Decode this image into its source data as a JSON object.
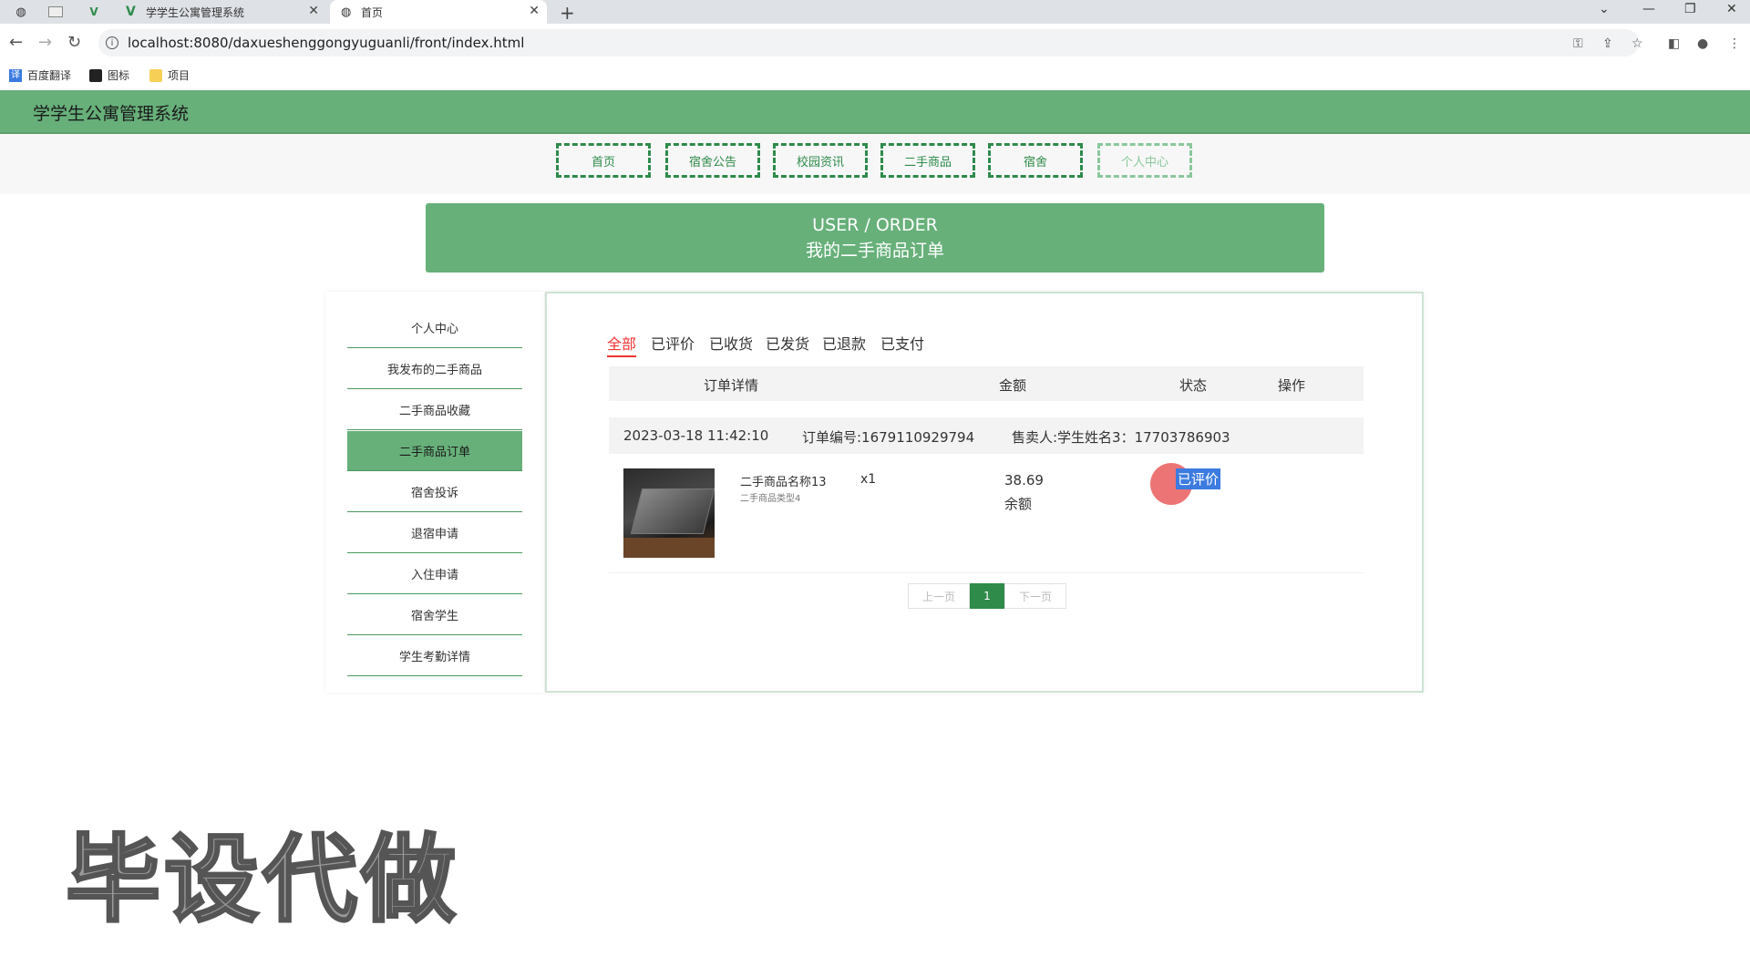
{
  "browser": {
    "tabs": [
      {
        "title": "学学生公寓管理系统"
      },
      {
        "title": "首页"
      }
    ],
    "url": "localhost:8080/daxueshenggongyuguanli/front/index.html",
    "bookmarks": [
      "百度翻译",
      "图标",
      "项目"
    ]
  },
  "site": {
    "title": "学学生公寓管理系统",
    "nav": [
      "首页",
      "宿舍公告",
      "校园资讯",
      "二手商品",
      "宿舍",
      "个人中心"
    ],
    "banner": {
      "en": "USER / ORDER",
      "cn": "我的二手商品订单"
    }
  },
  "sidebar": {
    "items": [
      "个人中心",
      "我发布的二手商品",
      "二手商品收藏",
      "二手商品订单",
      "宿舍投诉",
      "退宿申请",
      "入住申请",
      "宿舍学生",
      "学生考勤详情"
    ],
    "active_index": 3
  },
  "orders": {
    "filters": [
      "全部",
      "已评价",
      "已收货",
      "已发货",
      "已退款",
      "已支付"
    ],
    "active_filter": "全部",
    "columns": [
      "订单详情",
      "金额",
      "状态",
      "操作"
    ],
    "list": [
      {
        "time": "2023-03-18 11:42:10",
        "order_no": "订单编号:1679110929794",
        "seller": "售卖人:学生姓名3：17703786903",
        "item_name": "二手商品名称13",
        "item_type": "二手商品类型4",
        "qty": "x1",
        "amount": "38.69",
        "pay_method": "余额",
        "status": "已评价"
      }
    ]
  },
  "pagination": {
    "prev": "上一页",
    "current": "1",
    "next": "下一页"
  },
  "watermark": "毕设代做",
  "colors": {
    "primary": "#67b07a",
    "accent_dark": "#2e8b4a",
    "filter_active": "#e33"
  }
}
